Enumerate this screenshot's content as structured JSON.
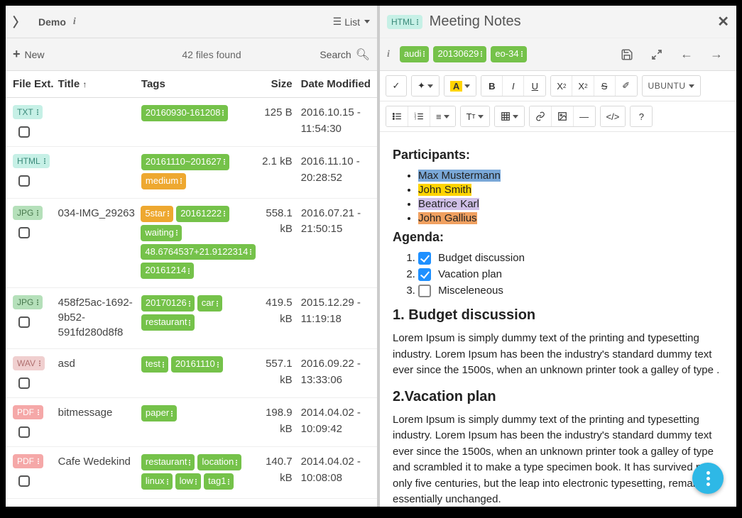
{
  "left": {
    "breadcrumb": "Demo",
    "view_mode": "List",
    "new_label": "New",
    "files_count": "42 files found",
    "search_label": "Search",
    "columns": {
      "ext": "File Ext.",
      "title": "Title",
      "tags": "Tags",
      "size": "Size",
      "date": "Date Modified"
    },
    "rows": [
      {
        "ext": "TXT",
        "ext_cls": "ext-txt",
        "title": "",
        "tags": [
          {
            "label": "20160930-161208",
            "cls": "tag-green"
          }
        ],
        "size": "125 B",
        "date": "2016.10.15 - 11:54:30"
      },
      {
        "ext": "HTML",
        "ext_cls": "ext-html",
        "title": "",
        "tags": [
          {
            "label": "20161110~201627",
            "cls": "tag-green"
          },
          {
            "label": "medium",
            "cls": "tag-orange"
          }
        ],
        "size": "2.1 kB",
        "date": "2016.11.10 - 20:28:52"
      },
      {
        "ext": "JPG",
        "ext_cls": "ext-jpg",
        "title": "034-IMG_29263",
        "tags": [
          {
            "label": "5star",
            "cls": "tag-orange"
          },
          {
            "label": "20161222",
            "cls": "tag-green"
          },
          {
            "label": "waiting",
            "cls": "tag-green"
          },
          {
            "label": "48.6764537+21.9122314",
            "cls": "tag-green"
          },
          {
            "label": "20161214",
            "cls": "tag-green"
          }
        ],
        "size": "558.1 kB",
        "date": "2016.07.21 - 21:50:15"
      },
      {
        "ext": "JPG",
        "ext_cls": "ext-jpg",
        "title": "458f25ac-1692-9b52-591fd280d8f8",
        "tags": [
          {
            "label": "20170126",
            "cls": "tag-green"
          },
          {
            "label": "car",
            "cls": "tag-green"
          },
          {
            "label": "restaurant",
            "cls": "tag-green"
          }
        ],
        "size": "419.5 kB",
        "date": "2015.12.29 - 11:19:18"
      },
      {
        "ext": "WAV",
        "ext_cls": "ext-wav",
        "title": "asd",
        "tags": [
          {
            "label": "test",
            "cls": "tag-green"
          },
          {
            "label": "20161110",
            "cls": "tag-green"
          }
        ],
        "size": "557.1 kB",
        "date": "2016.09.22 - 13:33:06"
      },
      {
        "ext": "PDF",
        "ext_cls": "ext-pdf",
        "title": "bitmessage",
        "tags": [
          {
            "label": "paper",
            "cls": "tag-green"
          }
        ],
        "size": "198.9 kB",
        "date": "2014.04.02 - 10:09:42"
      },
      {
        "ext": "PDF",
        "ext_cls": "ext-pdf",
        "title": "Cafe Wedekind",
        "tags": [
          {
            "label": "restaurant",
            "cls": "tag-green"
          },
          {
            "label": "location",
            "cls": "tag-green"
          },
          {
            "label": "linux",
            "cls": "tag-green"
          },
          {
            "label": "low",
            "cls": "tag-green"
          },
          {
            "label": "tag1",
            "cls": "tag-green"
          }
        ],
        "size": "140.7 kB",
        "date": "2014.04.02 - 10:08:08"
      }
    ]
  },
  "right": {
    "filetype": "HTML",
    "title": "Meeting Notes",
    "tags": [
      {
        "label": "audi",
        "cls": "tag-green"
      },
      {
        "label": "20130629",
        "cls": "tag-green"
      },
      {
        "label": "eo-34",
        "cls": "tag-green"
      }
    ],
    "font_name": "UBUNTU",
    "content": {
      "participants_heading": "Participants:",
      "participants": [
        {
          "name": "Max Mustermann",
          "hl": "hl-blue"
        },
        {
          "name": "John Smith",
          "hl": "hl-yellow"
        },
        {
          "name": "Beatrice Karl",
          "hl": "hl-violet"
        },
        {
          "name": "John Gallius",
          "hl": "hl-orange"
        }
      ],
      "agenda_heading": "Agenda:",
      "agenda": [
        {
          "label": "Budget discussion",
          "checked": true
        },
        {
          "label": "Vacation plan",
          "checked": true
        },
        {
          "label": "Misceleneous",
          "checked": false
        }
      ],
      "sec1_title": "1. Budget discussion",
      "sec1_body": "Lorem Ipsum is simply dummy text of the printing and typesetting industry. Lorem Ipsum has been the industry's standard dummy text ever since the 1500s, when an unknown printer took a galley of type .",
      "sec2_title": "2.Vacation plan",
      "sec2_body": "Lorem Ipsum is simply dummy text of the printing and typesetting industry. Lorem Ipsum has been the industry's standard dummy text ever since the 1500s, when an unknown printer took a galley of type and scrambled it to make a type specimen book. It has survived not only five centuries, but the leap into electronic typesetting, remaining essentially unchanged."
    }
  }
}
